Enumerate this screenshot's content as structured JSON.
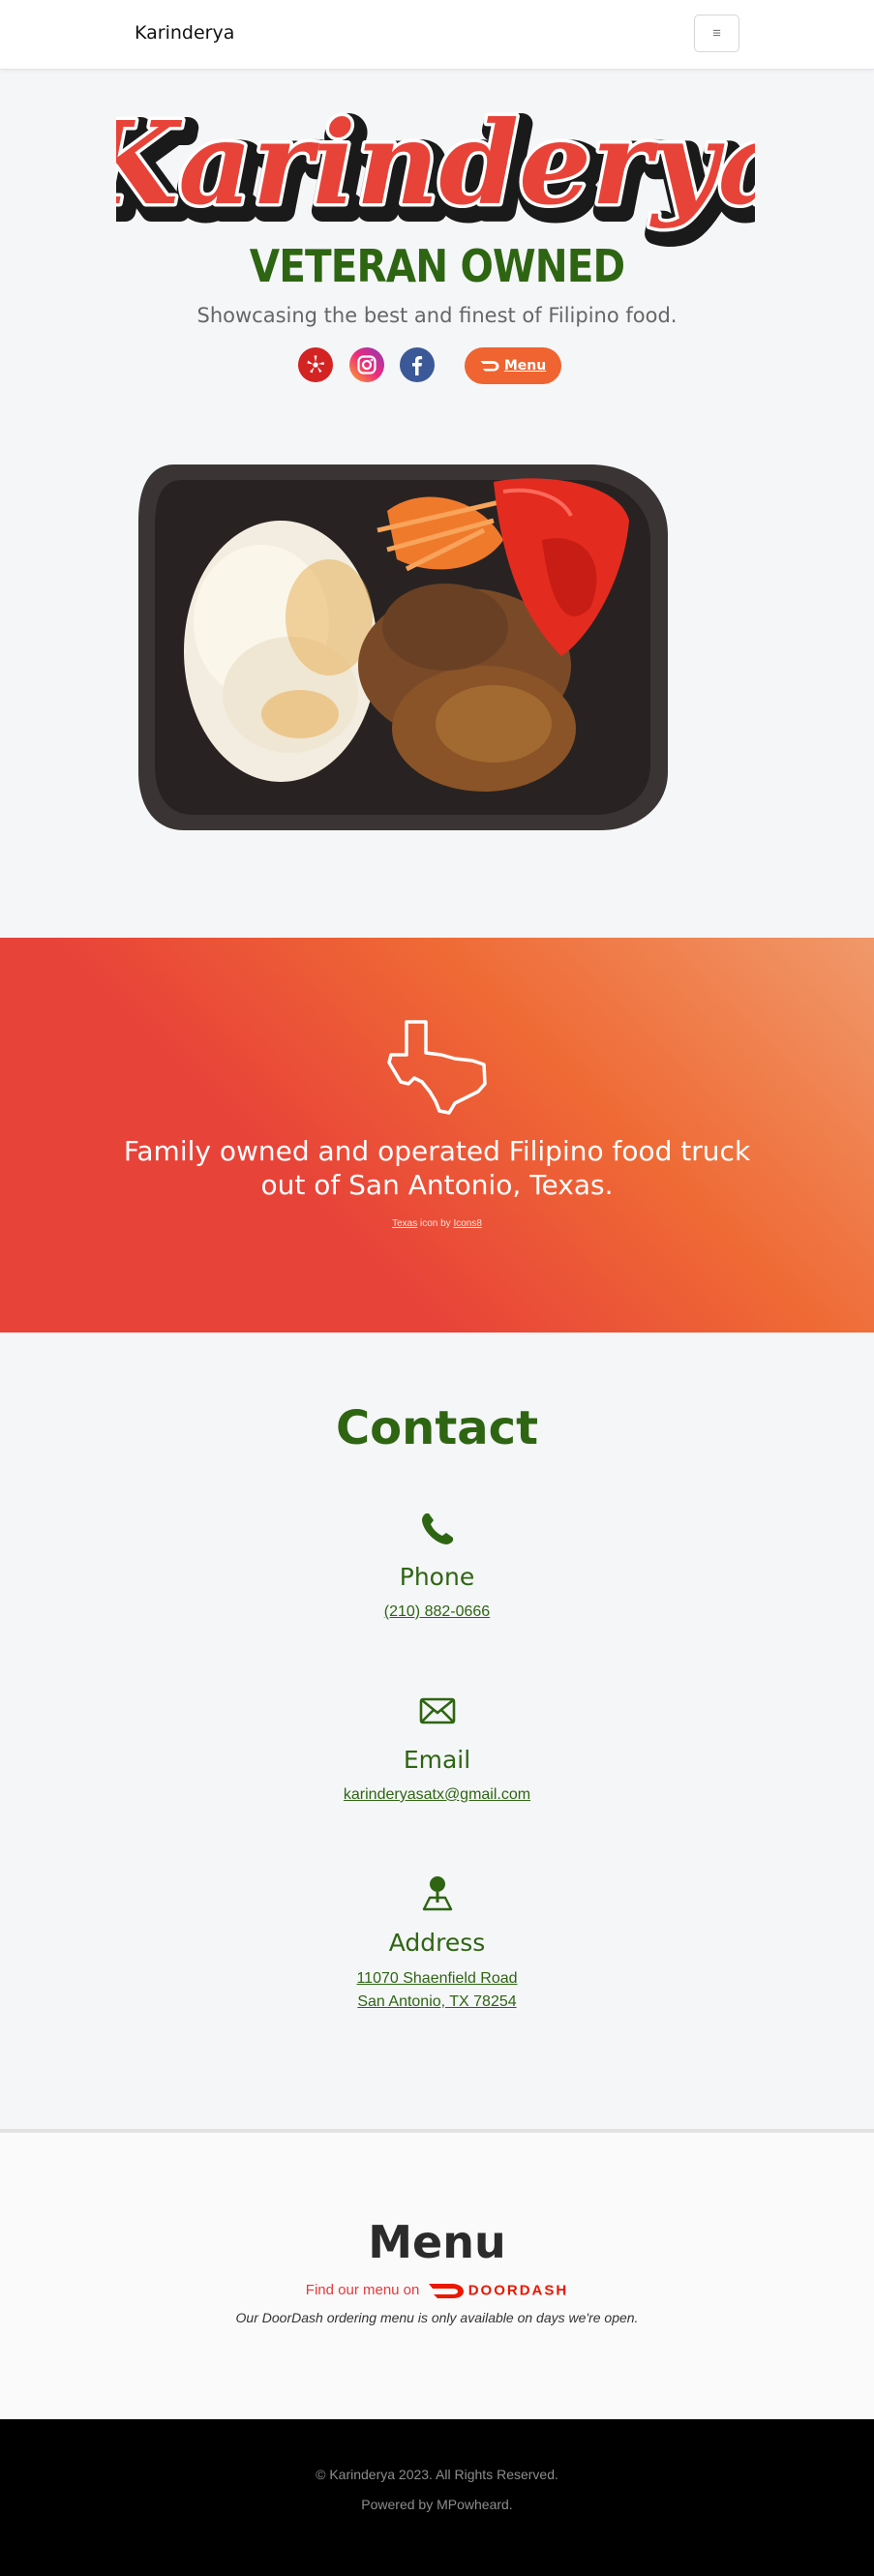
{
  "navbar": {
    "brand": "Karinderya",
    "toggle_glyph": "≡"
  },
  "hero": {
    "logo_text": "Karinderya",
    "veteran": "VETERAN OWNED",
    "tagline": "Showcasing the best and finest of Filipino food.",
    "social_icons": [
      "yelp-icon",
      "instagram-icon",
      "facebook-icon"
    ],
    "menu_button": "Menu"
  },
  "banner": {
    "line1": "Family owned and operated Filipino food truck",
    "line2": "out of San Antonio, Texas.",
    "credit_link1": "Texas",
    "credit_mid": " icon by ",
    "credit_link2": "Icons8"
  },
  "contact": {
    "title": "Contact",
    "phone_label": "Phone",
    "phone": "(210) 882-0666",
    "email_label": "Email",
    "email": "karinderyasatx@gmail.com",
    "address_label": "Address",
    "address_line1": "11070 Shaenfield Road",
    "address_line2": "San Antonio, TX 78254"
  },
  "menu": {
    "title": "Menu",
    "find_prefix": "Find our menu on",
    "doordash": "DOORDASH",
    "note": "Our DoorDash ordering menu is only available on days we're open."
  },
  "footer": {
    "copyright": "© Karinderya 2023. All Rights Reserved.",
    "powered": "Powered by MPowheard."
  },
  "colors": {
    "brand_green": "#2e6512",
    "accent_orange": "#ef6430",
    "banner_red": "#e84339",
    "doordash_red": "#eb1700",
    "footer_bg": "#000000"
  }
}
